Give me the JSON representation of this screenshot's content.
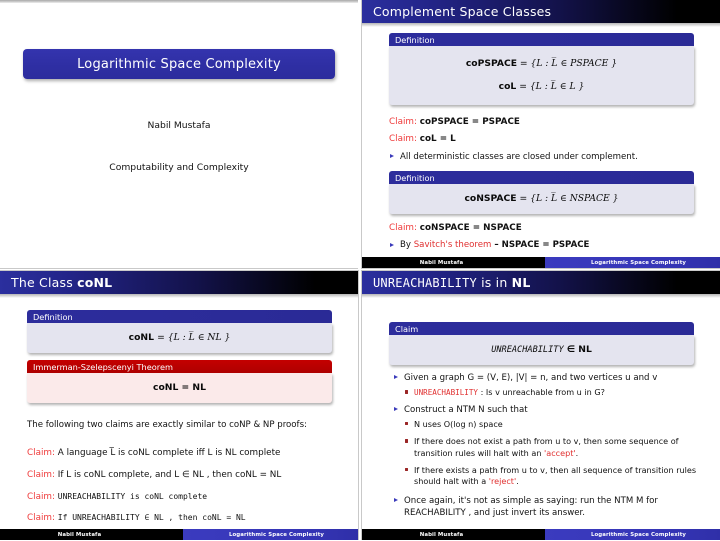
{
  "footer": {
    "author": "Nabil Mustafa",
    "title": "Logarithmic Space Complexity"
  },
  "colors": {
    "block_header_blue": "#2b2b98",
    "block_body_blue": "#e4e4ef",
    "theorem_header_red": "#be0000",
    "theorem_body_red": "#fbeaea",
    "claim_red": "#ef3b3b",
    "title_box_blue": "#2f2fa4",
    "bullet_blue": "#3b3bbb"
  },
  "slide_title": {
    "title": "Logarithmic Space Complexity",
    "author": "Nabil Mustafa",
    "institute": "Computability and Complexity"
  },
  "slide_complement": {
    "header": "Complement Space Classes",
    "block1": {
      "header": "Definition",
      "line1": "coPSPACE = {L : L̅ ∈ PSPACE }",
      "line1_lhs": "coPSPACE",
      "line1_rhs_set": "{L : L̅ ∈ PSPACE }",
      "line2_lhs": "coL",
      "line2_rhs_set": "{L : L̅ ∈ L }"
    },
    "claim1_label": "Claim:",
    "claim1_text": "coPSPACE = PSPACE",
    "claim2_label": "Claim:",
    "claim2_text": "coL = L",
    "bullet1": "All deterministic classes are closed under complement.",
    "block2": {
      "header": "Definition",
      "line1_lhs": "coNSPACE",
      "line1_rhs_set": "{L : L̅ ∈ NSPACE }"
    },
    "claim3_label": "Claim:",
    "claim3_text": "coNSPACE = NSPACE",
    "bullet2_pre": "By ",
    "bullet2_em": "Savitch's theorem",
    "bullet2_post": " – NSPACE  = PSPACE"
  },
  "slide_conl": {
    "header_pre": "The Class ",
    "header_bold": "coNL",
    "block1": {
      "header": "Definition",
      "line1_lhs": "coNL ",
      "line1_rhs_set": "{L : L̅ ∈ NL }"
    },
    "block2": {
      "header": "Immerman-Szelepscenyi Theorem",
      "line1": "coNL  = NL"
    },
    "para": "The following two claims are exactly similar to coNP & NP proofs:",
    "claims": [
      {
        "label": "Claim:",
        "text": "A language L̅ is coNL complete iff L is NL complete"
      },
      {
        "label": "Claim:",
        "text": "If L is coNL complete, and L ∈ NL , then coNL  = NL"
      },
      {
        "label": "Claim:",
        "text": "UNREACHABILITY  is coNL complete"
      },
      {
        "label": "Claim:",
        "text": "If UNREACHABILITY ∈ NL , then coNL  = NL"
      }
    ]
  },
  "slide_unreach": {
    "header_mono": "UNREACHABILITY",
    "header_mid": " is in ",
    "header_bold": "NL",
    "block1": {
      "header": "Claim",
      "line1_mono": "UNREACHABILITY",
      "line1_rest": " ∈ NL"
    },
    "bullets": [
      {
        "text": "Given a graph G = (V, E), |V| = n, and two vertices u and v",
        "sub": [
          {
            "mono": "UNREACHABILITY",
            "rest": " : Is v unreachable from u in G?"
          }
        ]
      },
      {
        "text": "Construct a NTM N such that",
        "sub": [
          {
            "text": "N uses O(log n) space"
          },
          {
            "text": "If there does not exist a path from u to v, then some sequence of transition rules will halt with an ",
            "quoted": "'accept'",
            "tail": "."
          },
          {
            "text": "If there exists a path from u to v, then all sequence of transition rules should halt with a ",
            "quoted": "'reject'",
            "tail": "."
          }
        ]
      },
      {
        "text": "Once again, it's not as simple as saying: run the NTM M for REACHABILITY , and just invert its answer.",
        "sub": []
      }
    ]
  }
}
